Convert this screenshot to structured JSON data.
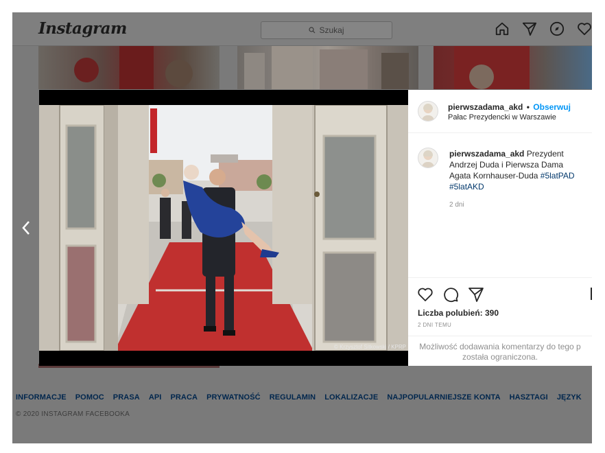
{
  "header": {
    "logo": "Instagram",
    "search_placeholder": "Szukaj"
  },
  "post": {
    "username": "pierwszadama_akd",
    "separator": "•",
    "follow_label": "Obserwuj",
    "location": "Pałac Prezydencki w Warszawie",
    "photo_credit": "© Krzysztof Sitkowski / KPRP",
    "caption": {
      "text": "Prezydent Andrzej Duda i Pierwsza Dama Agata Kornhauser-Duda",
      "hashtags": [
        "#5latPAD",
        "#5latAKD"
      ]
    },
    "caption_time": "2 dni",
    "likes_label": "Liczba polubień: 390",
    "date_uppercase": "2 DNI TEMU",
    "comments_disabled_line1": "Możliwość dodawania komentarzy do tego p",
    "comments_disabled_line2": "została ograniczona."
  },
  "footer": {
    "links": [
      "INFORMACJE",
      "POMOC",
      "PRASA",
      "API",
      "PRACA",
      "PRYWATNOŚĆ",
      "REGULAMIN",
      "LOKALIZACJE",
      "NAJPOPULARNIEJSZE KONTA",
      "HASZTAGI",
      "JĘZYK"
    ],
    "copyright": "© 2020 INSTAGRAM FACEBOOKA"
  },
  "icons": {
    "nav": [
      "home-icon",
      "direct-icon",
      "explore-icon",
      "heart-icon"
    ],
    "actions": [
      "like-icon",
      "comment-icon",
      "share-icon"
    ],
    "carousel": "chevron-left-icon"
  },
  "colors": {
    "link_blue": "#0095f6",
    "hashtag": "#00376b",
    "overlay": "#7a7a7a"
  }
}
